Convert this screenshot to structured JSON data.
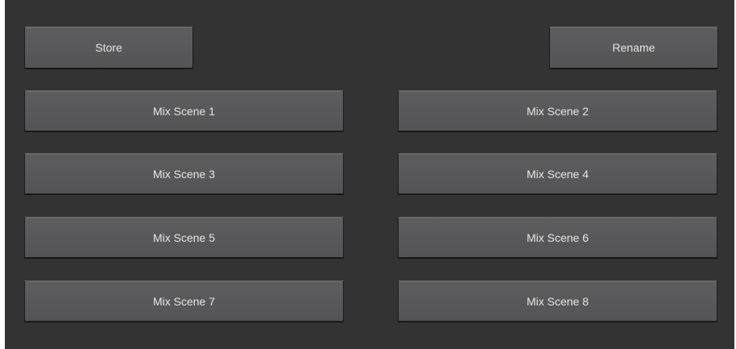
{
  "toolbar": {
    "store_label": "Store",
    "rename_label": "Rename"
  },
  "scenes": [
    {
      "label": "Mix Scene 1"
    },
    {
      "label": "Mix Scene 2"
    },
    {
      "label": "Mix Scene 3"
    },
    {
      "label": "Mix Scene 4"
    },
    {
      "label": "Mix Scene 5"
    },
    {
      "label": "Mix Scene 6"
    },
    {
      "label": "Mix Scene 7"
    },
    {
      "label": "Mix Scene 8"
    }
  ],
  "colors": {
    "panel_background": "#333333",
    "button_background": "#5a5a5c",
    "button_text": "#e6e6e6"
  }
}
